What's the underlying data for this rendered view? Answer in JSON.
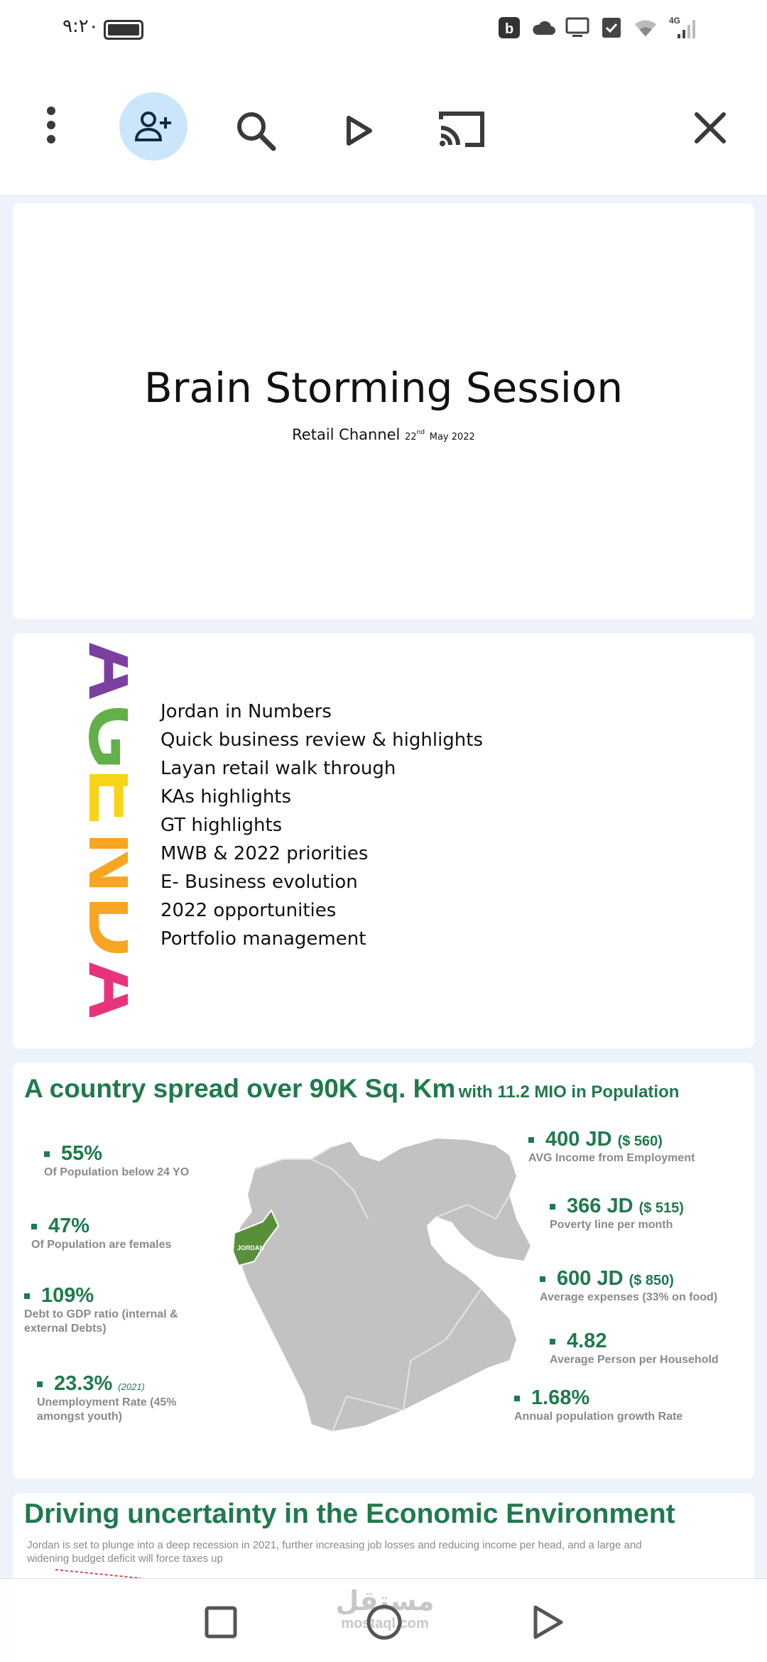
{
  "status_bar": {
    "time": "٩:٢٠",
    "network": "4G",
    "icons": [
      "b-icon",
      "cloud-icon",
      "monitor-icon",
      "clipboard-check-icon",
      "wifi-icon",
      "signal-icon"
    ]
  },
  "toolbar": {
    "icons": [
      "more-vert-icon",
      "person-add-icon",
      "search-icon",
      "play-icon",
      "cast-icon",
      "close-icon"
    ],
    "accent_color": "#cbe6fb"
  },
  "slide1": {
    "title": "Brain Storming Session",
    "subtitle": "Retail Channel",
    "date_day": "22",
    "date_suffix": "nd",
    "date_rest": "May 2022"
  },
  "slide2": {
    "agenda_letters": [
      "A",
      "G",
      "E",
      "N",
      "D",
      "A"
    ],
    "agenda_colors": [
      "#7b3fa0",
      "#62b04a",
      "#f7d417",
      "#f6a623",
      "#e8327c"
    ],
    "items": [
      "Jordan in Numbers",
      "Quick business review & highlights",
      "Layan retail walk through",
      "KAs highlights",
      "GT highlights",
      "MWB & 2022 priorities",
      "E- Business evolution",
      "2022 opportunities",
      "Portfolio management"
    ]
  },
  "slide3": {
    "title_main": "A country spread over 90K Sq. Km",
    "title_sub": "with 11.2 MIO in Population",
    "map_label": "JORDAN",
    "accent_color": "#1f7a4c",
    "left_stats": [
      {
        "value": "55%",
        "desc": "Of Population below 24 YO"
      },
      {
        "value": "47%",
        "desc": "Of Population are females"
      },
      {
        "value": "109%",
        "desc": "Debt to GDP ratio (internal & external Debts)"
      },
      {
        "value": "23.3%",
        "tiny": "(2021)",
        "desc": "Unemployment Rate (45% amongst youth)"
      }
    ],
    "right_stats": [
      {
        "value": "400 JD",
        "extra": "($ 560)",
        "desc": "AVG Income from Employment"
      },
      {
        "value": "366 JD",
        "extra": "($ 515)",
        "desc": "Poverty line per month"
      },
      {
        "value": "600 JD",
        "extra": "($ 850)",
        "desc": "Average expenses (33% on food)"
      },
      {
        "value": "4.82",
        "desc": "Average Person per Household"
      },
      {
        "value": "1.68%",
        "desc": "Annual population growth Rate"
      }
    ]
  },
  "slide4": {
    "title": "Driving uncertainty in the Economic Environment",
    "desc": "Jordan is set to plunge into a deep recession in 2021, further increasing job losses and reducing income per head, and a large and widening budget deficit will force taxes up"
  },
  "navbar": {
    "watermark_ar": "مستقل",
    "watermark_en": "mostaql.com",
    "icons": [
      "recents-square-icon",
      "home-circle-icon",
      "back-triangle-icon"
    ]
  }
}
